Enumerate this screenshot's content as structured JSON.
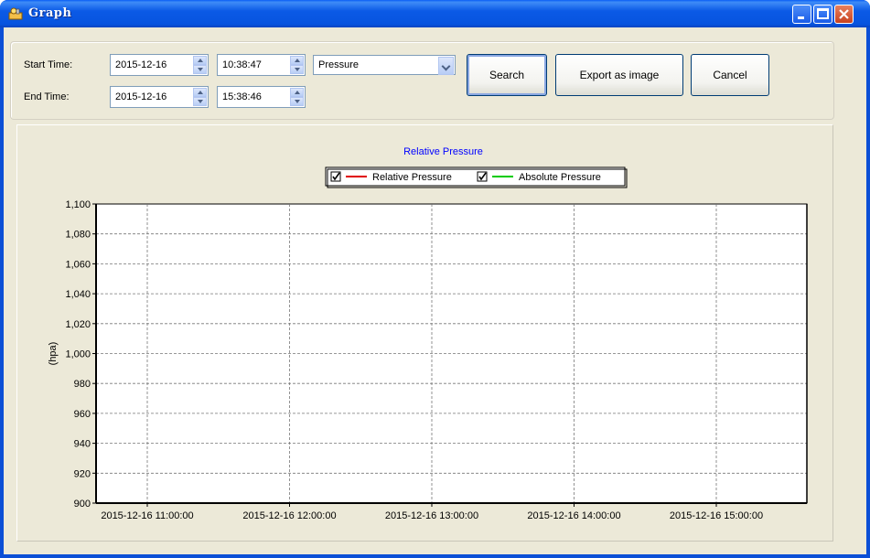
{
  "window": {
    "title": "Graph"
  },
  "controls": {
    "start_time_label": "Start Time:",
    "end_time_label": "End Time:",
    "start_date": "2015-12-16",
    "start_time": "10:38:47",
    "end_date": "2015-12-16",
    "end_time": "15:38:46",
    "measure_select": "Pressure",
    "search_label": "Search",
    "export_label": "Export as image",
    "cancel_label": "Cancel"
  },
  "chart_data": {
    "type": "line",
    "title": "Relative Pressure",
    "xlabel": "",
    "ylabel": "(hpa)",
    "ylim": [
      900,
      1100
    ],
    "y_ticks": [
      "1,100",
      "1,080",
      "1,060",
      "1,040",
      "1,020",
      "1,000",
      "980",
      "960",
      "940",
      "920",
      "900"
    ],
    "x_ticks": [
      "2015-12-16 11:00:00",
      "2015-12-16 12:00:00",
      "2015-12-16 13:00:00",
      "2015-12-16 14:00:00",
      "2015-12-16 15:00:00"
    ],
    "legend_position": "top-center",
    "grid": true,
    "series": [
      {
        "name": "Relative Pressure",
        "color": "#e00000",
        "checked": true,
        "values": []
      },
      {
        "name": "Absolute Pressure",
        "color": "#00cc00",
        "checked": true,
        "values": []
      }
    ]
  }
}
